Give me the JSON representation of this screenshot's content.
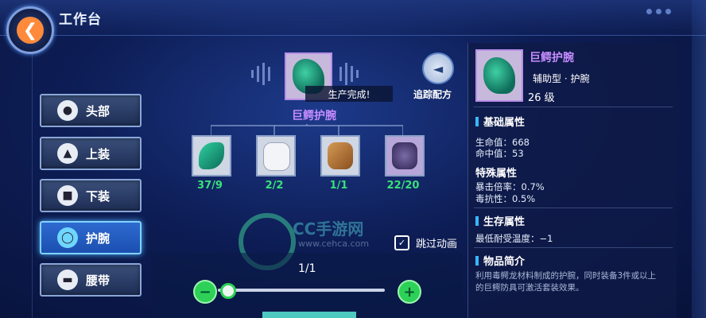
{
  "header": {
    "title": "工作台",
    "back_icon": "back-arrow-icon"
  },
  "tabs": [
    {
      "label": "头部",
      "icon": "helmet-icon",
      "active": false
    },
    {
      "label": "上装",
      "icon": "armor-icon",
      "active": false
    },
    {
      "label": "下装",
      "icon": "pants-icon",
      "active": false
    },
    {
      "label": "护腕",
      "icon": "bracer-icon",
      "active": true
    },
    {
      "label": "腰带",
      "icon": "belt-icon",
      "active": false
    }
  ],
  "craft": {
    "status": "生产完成!",
    "item_name": "巨鳄护腕",
    "track_label": "追踪配方",
    "materials": [
      {
        "count": "37/9",
        "color": "#2fd0a0",
        "bg": "#cfd6e4"
      },
      {
        "count": "2/2",
        "color": "#e8ecf4",
        "bg": "#cfd6e4"
      },
      {
        "count": "1/1",
        "color": "#b87a3a",
        "bg": "#cfd6e4"
      },
      {
        "count": "22/20",
        "color": "#5b4a86",
        "bg": "#b7a6d8"
      }
    ],
    "watermark_text": "CC手游网",
    "watermark_url": "www.cehca.com",
    "skip_label": "跳过动画",
    "quantity": "1/1",
    "slider_fraction": 0.0
  },
  "detail": {
    "name": "巨鳄护腕",
    "type": "辅助型 · 护腕",
    "level": "26 级",
    "base_title": "基础属性",
    "base": [
      "生命值：668",
      "命中值：53"
    ],
    "special_title": "特殊属性",
    "special": [
      "暴击倍率：0.7%",
      "毒抗性：0.5%"
    ],
    "survive_title": "生存属性",
    "survive": [
      "最低耐受温度：−1"
    ],
    "intro_title": "物品简介",
    "intro": "利用毒鳄龙材料制成的护腕，同时装备3件或以上的巨鳄防具可激活套装效果。"
  },
  "colors": {
    "accent": "#c68cff",
    "green": "#39e07a",
    "blue": "#39b8ff"
  }
}
